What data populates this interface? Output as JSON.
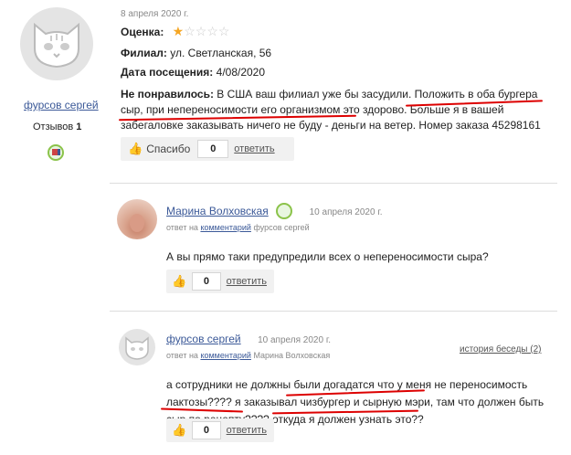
{
  "review": {
    "author": "фурсов сергей",
    "reviews_label": "Отзывов",
    "reviews_count": "1",
    "date": "8 апреля 2020 г.",
    "rating_label": "Оценка:",
    "rating_value": 1,
    "rating_max": 5,
    "branch_label": "Филиал:",
    "branch_value": "ул. Светланская, 56",
    "visit_label": "Дата посещения:",
    "visit_value": "4/08/2020",
    "dislike_label": "Не понравилось:",
    "dislike_line1": "В США ваш филиал уже бы засудили. Положить в оба бургера",
    "dislike_line2": "сыр, при непереносимости его организмом это здорово. Больше я в вашей",
    "dislike_line3": "забегаловке заказывать ничего не буду - деньги на ветер. Номер заказа 45298161",
    "thanks_label": "Спасибо",
    "thanks_count": "0",
    "reply_label": "ответить"
  },
  "comments": [
    {
      "author": "Марина Волховская",
      "date": "10 апреля 2020 г.",
      "meta_prefix": "ответ на",
      "meta_link": "комментарий",
      "meta_to": "фурсов сергей",
      "text": "А вы прямо таки предупредили всех о непереносимости сыра?",
      "count": "0",
      "reply_label": "ответить"
    },
    {
      "author": "фурсов сергей",
      "date": "10 апреля 2020 г.",
      "meta_prefix": "ответ на",
      "meta_link": "комментарий",
      "meta_to": "Марина Волховская",
      "history": "история беседы (2)",
      "text_line1": "а сотрудники не должны были догадатся что у меня не переносимость",
      "text_line2": "лактозы???? я заказывал чизбургер и сырную мэри, там что должен быть",
      "text_line3": "сыр по рецепту???? откуда я должен узнать это??",
      "count": "0",
      "reply_label": "ответить"
    }
  ],
  "colors": {
    "link": "#3b5998",
    "star": "#f5a623",
    "annotation": "#dd0000"
  }
}
